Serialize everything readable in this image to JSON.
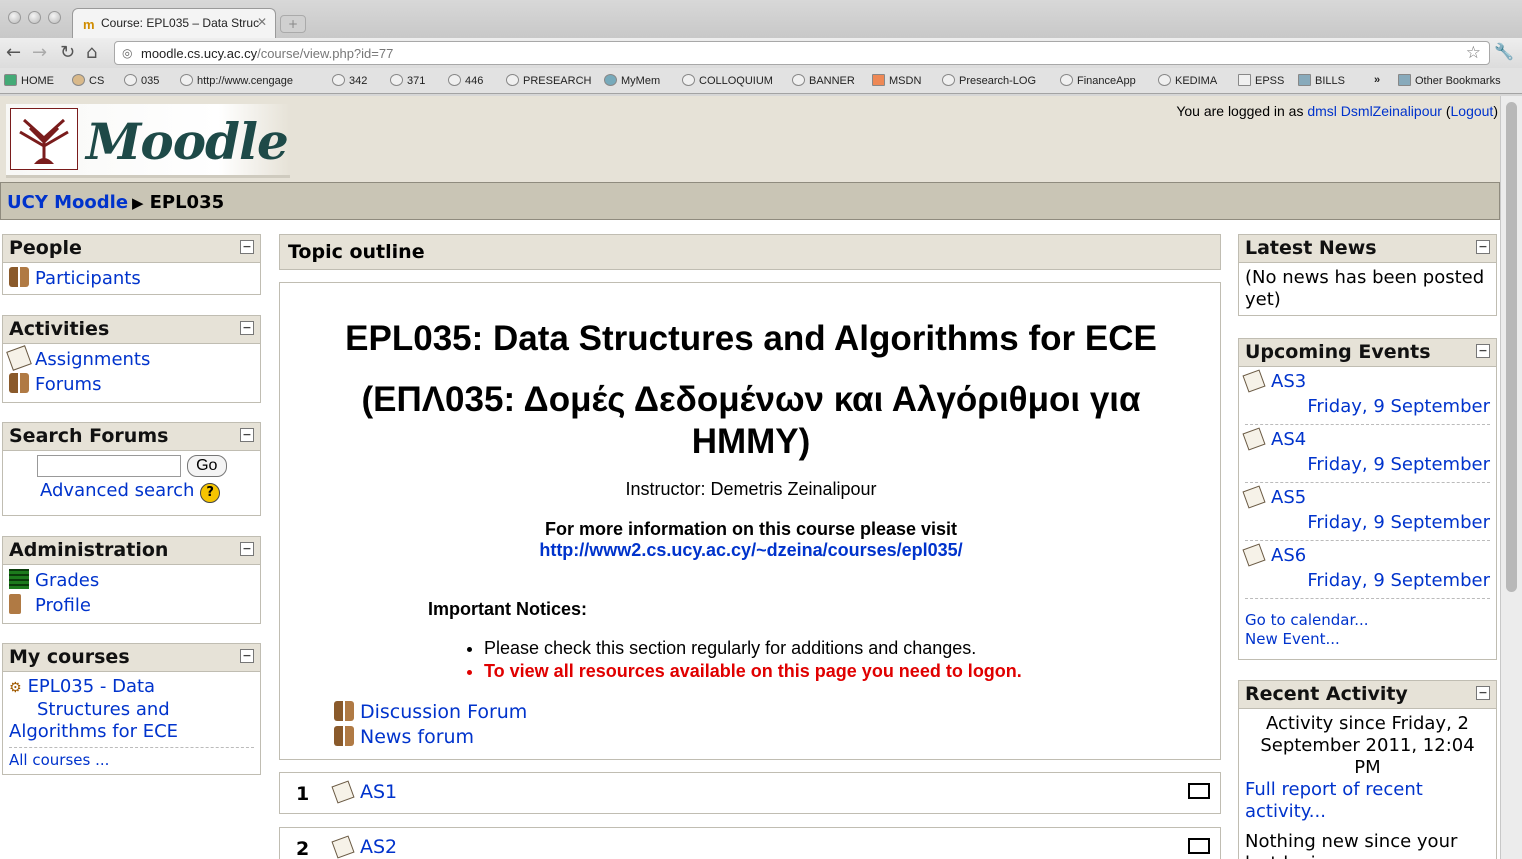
{
  "browser": {
    "tab_title": "Course: EPL035 – Data Struc",
    "url_host": "moodle.cs.ucy.ac.cy",
    "url_path": "/course/view.php?id=77",
    "bookmarks": [
      "HOME",
      "CS",
      "035",
      "http://www.cengage",
      "342",
      "371",
      "446",
      "PRESEARCH",
      "MyMem",
      "COLLOQUIUM",
      "BANNER",
      "MSDN",
      "Presearch-LOG",
      "FinanceApp",
      "KEDIMA",
      "EPSS",
      "BILLS",
      "»",
      "Other Bookmarks"
    ]
  },
  "header": {
    "logo_text": "Moodle",
    "login_prefix": "You are logged in as ",
    "user_name": "dmsl DsmlZeinalipour",
    "logout_label": "Logout"
  },
  "breadcrumb": {
    "home": "UCY Moodle",
    "arrow": "▶",
    "current": "EPL035"
  },
  "left_blocks": {
    "people": {
      "title": "People",
      "items": [
        "Participants"
      ]
    },
    "activities": {
      "title": "Activities",
      "items": [
        "Assignments",
        "Forums"
      ]
    },
    "search": {
      "title": "Search Forums",
      "go_label": "Go",
      "advanced_label": "Advanced search",
      "help": "?"
    },
    "admin": {
      "title": "Administration",
      "items": [
        "Grades",
        "Profile"
      ]
    },
    "mycourses": {
      "title": "My courses",
      "course_line1": "EPL035 - Data",
      "course_line2": "Structures and",
      "course_line3": "Algorithms for ECE",
      "all_courses": "All courses ..."
    }
  },
  "center": {
    "topic_header": "Topic outline",
    "course_title": "EPL035: Data Structures and Algorithms for ECE",
    "course_title_gr": "(ΕΠΛ035: Δομές Δεδομένων και Αλγόριθμοι για ΗΜΜΥ)",
    "instructor": "Instructor: Demetris Zeinalipour",
    "moreinfo": "For more information on this course please visit",
    "moreinfo_link": "http://www2.cs.ucy.ac.cy/~dzeina/courses/epl035/",
    "notices_title": "Important Notices:",
    "notices": [
      "Please check this section regularly for additions and changes.",
      "To view all resources available on this page you need to logon."
    ],
    "forums": [
      "Discussion Forum",
      "News forum"
    ],
    "sections": [
      {
        "num": "1",
        "item": "AS1"
      },
      {
        "num": "2",
        "item": "AS2"
      }
    ]
  },
  "right_blocks": {
    "news": {
      "title": "Latest News",
      "text": "(No news has been posted yet)"
    },
    "events": {
      "title": "Upcoming Events",
      "items": [
        {
          "name": "AS3",
          "date": "Friday, 9 September"
        },
        {
          "name": "AS4",
          "date": "Friday, 9 September"
        },
        {
          "name": "AS5",
          "date": "Friday, 9 September"
        },
        {
          "name": "AS6",
          "date": "Friday, 9 September"
        }
      ],
      "goto_calendar": "Go to calendar...",
      "new_event": "New Event..."
    },
    "recent": {
      "title": "Recent Activity",
      "since": "Activity since Friday, 2 September 2011, 12:04 PM",
      "full_report": "Full report of recent activity...",
      "nothing_new": "Nothing new since your last login"
    }
  },
  "colors": {
    "block_header": "#e6e2d7",
    "link": "#0033cc",
    "notice_red": "#e00000"
  }
}
